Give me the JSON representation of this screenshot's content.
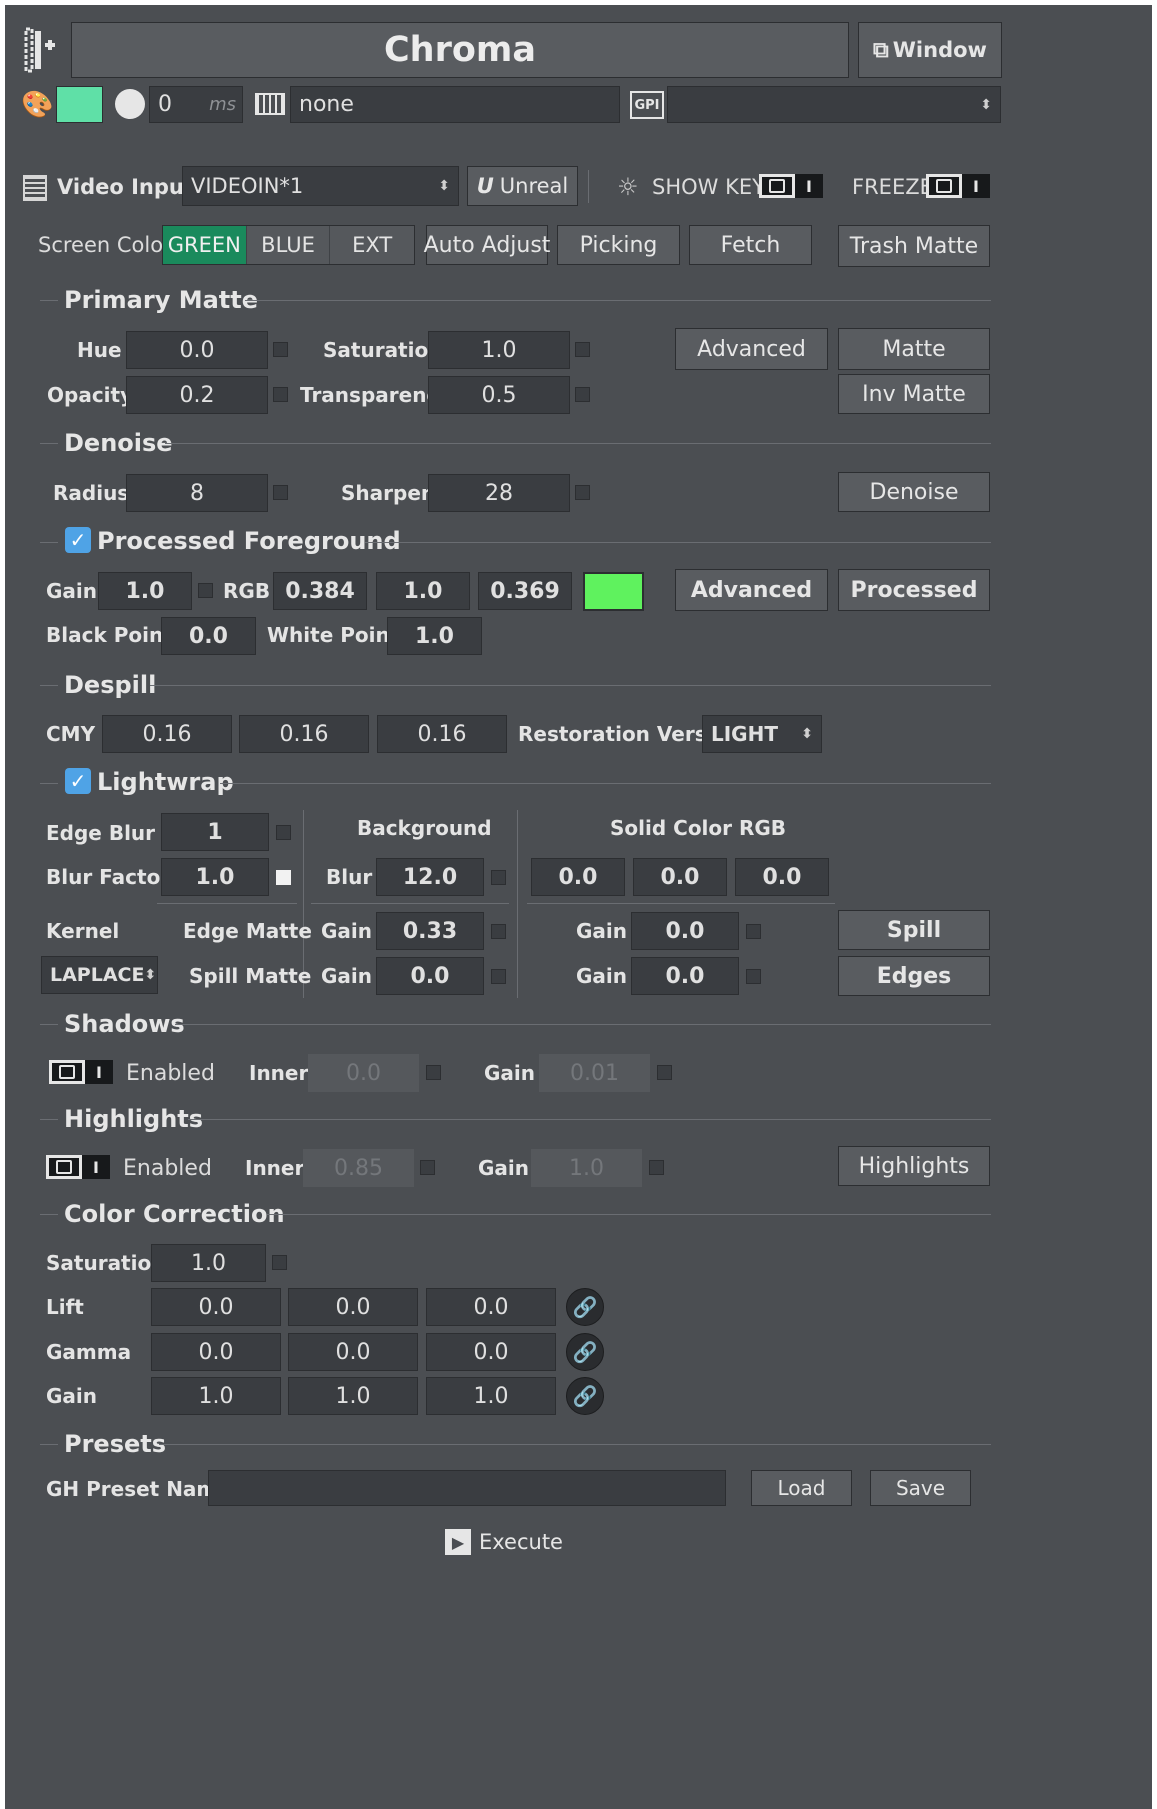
{
  "header": {
    "title": "Chroma",
    "window_button": "Window",
    "color_swatch": "#5fe0a7",
    "delay_value": "0",
    "delay_unit": "ms",
    "keyboard_value": "none",
    "gpi_label": "GPI",
    "gpi_value": ""
  },
  "video": {
    "input_label": "Video Input:",
    "input_value": "VIDEOIN*1",
    "unreal_button": "Unreal",
    "show_key_label": "SHOW KEY",
    "freeze_label": "FREEZE",
    "toggle_bar": "I"
  },
  "screen_color": {
    "label": "Screen Color",
    "options": [
      "GREEN",
      "BLUE",
      "EXT"
    ],
    "selected": "GREEN",
    "auto_adjust": "Auto Adjust",
    "picking": "Picking",
    "fetch": "Fetch",
    "trash_matte": "Trash Matte"
  },
  "primary_matte": {
    "title": "Primary Matte",
    "hue_label": "Hue",
    "hue": "0.0",
    "saturation_label": "Saturation",
    "saturation": "1.0",
    "opacity_label": "Opacity",
    "opacity": "0.2",
    "transparency_label": "Transparency",
    "transparency": "0.5",
    "advanced": "Advanced",
    "matte": "Matte",
    "inv_matte": "Inv Matte"
  },
  "denoise": {
    "title": "Denoise",
    "radius_label": "Radius",
    "radius": "8",
    "sharpen_label": "Sharpen",
    "sharpen": "28",
    "button": "Denoise"
  },
  "processed_foreground": {
    "title": "Processed Foreground",
    "checked": true,
    "gain_label": "Gain",
    "gain": "1.0",
    "rgb_label": "RGB",
    "r": "0.384",
    "g": "1.0",
    "b": "0.369",
    "color": "#5ff25e",
    "advanced": "Advanced",
    "processed": "Processed",
    "black_point_label": "Black Point",
    "black_point": "0.0",
    "white_point_label": "White Point",
    "white_point": "1.0"
  },
  "despill": {
    "title": "Despill",
    "cmy_label": "CMY",
    "c": "0.16",
    "m": "0.16",
    "y": "0.16",
    "restoration_label": "Restoration Version",
    "restoration_value": "LIGHT"
  },
  "lightwrap": {
    "title": "Lightwrap",
    "checked": true,
    "edge_blur_label": "Edge Blur",
    "edge_blur": "1",
    "blur_factor_label": "Blur Factor",
    "blur_factor": "1.0",
    "background_label": "Background",
    "blur_label": "Blur",
    "blur": "12.0",
    "solid_color_label": "Solid Color RGB",
    "solid_r": "0.0",
    "solid_g": "0.0",
    "solid_b": "0.0",
    "kernel_label": "Kernel",
    "kernel_value": "LAPLACE",
    "edge_matte_label": "Edge Matte",
    "spill_matte_label": "Spill Matte",
    "gain_label": "Gain",
    "edge_bg_gain": "0.33",
    "spill_bg_gain": "0.0",
    "edge_solid_gain": "0.0",
    "spill_solid_gain": "0.0",
    "spill_button": "Spill",
    "edges_button": "Edges"
  },
  "shadows": {
    "title": "Shadows",
    "enabled_label": "Enabled",
    "inner_label": "Inner",
    "inner": "0.0",
    "gain_label": "Gain",
    "gain": "0.01"
  },
  "highlights": {
    "title": "Highlights",
    "enabled_label": "Enabled",
    "inner_label": "Inner",
    "inner": "0.85",
    "gain_label": "Gain",
    "gain": "1.0",
    "button": "Highlights"
  },
  "color_correction": {
    "title": "Color Correction",
    "saturation_label": "Saturation",
    "saturation": "1.0",
    "lift_label": "Lift",
    "lift": [
      "0.0",
      "0.0",
      "0.0"
    ],
    "gamma_label": "Gamma",
    "gamma": [
      "0.0",
      "0.0",
      "0.0"
    ],
    "gain_label": "Gain",
    "gain": [
      "1.0",
      "1.0",
      "1.0"
    ]
  },
  "presets": {
    "title": "Presets",
    "name_label": "GH Preset Name",
    "name_value": "",
    "load": "Load",
    "save": "Save"
  },
  "execute": "Execute"
}
